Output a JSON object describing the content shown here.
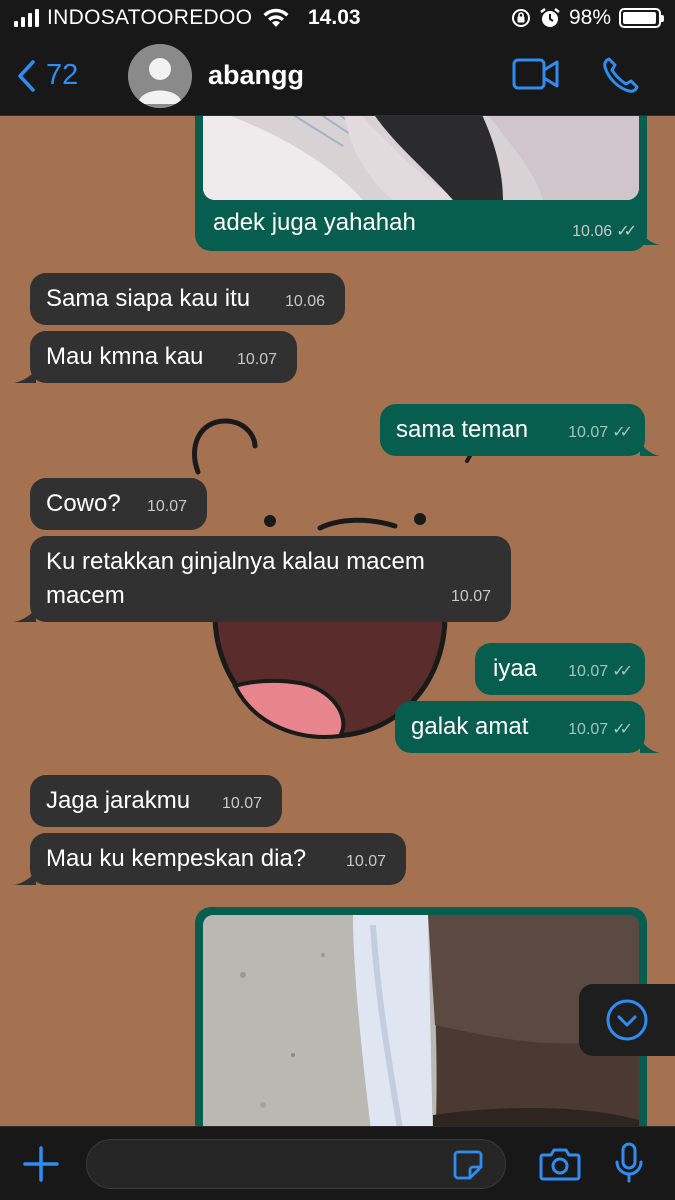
{
  "status_bar": {
    "carrier": "INDOSATOOREDOO",
    "time": "14.03",
    "battery": "98%",
    "battery_level": 0.98
  },
  "header": {
    "back_count": "72",
    "contact_name": "abangg"
  },
  "messages": [
    {
      "id": "m1",
      "dir": "out",
      "text": "adek juga yahahah",
      "time": "10.06",
      "has_media": true
    },
    {
      "id": "m2",
      "dir": "in",
      "text": "Sama siapa kau itu",
      "time": "10.06"
    },
    {
      "id": "m3",
      "dir": "in",
      "text": "Mau kmna kau",
      "time": "10.07"
    },
    {
      "id": "m4",
      "dir": "out",
      "text": "sama teman",
      "time": "10.07"
    },
    {
      "id": "m5",
      "dir": "in",
      "text": "Cowo?",
      "time": "10.07"
    },
    {
      "id": "m6",
      "dir": "in",
      "text": "Ku retakkan ginjalnya kalau macem macem",
      "time": "10.07"
    },
    {
      "id": "m7",
      "dir": "out",
      "text": "iyaa",
      "time": "10.07"
    },
    {
      "id": "m8",
      "dir": "out",
      "text": "galak amat",
      "time": "10.07"
    },
    {
      "id": "m9",
      "dir": "in",
      "text": "Jaga jarakmu",
      "time": "10.07"
    },
    {
      "id": "m10",
      "dir": "in",
      "text": "Mau ku kempeskan dia?",
      "time": "10.07"
    },
    {
      "id": "m11",
      "dir": "out",
      "text": "",
      "time": "",
      "has_media": true
    }
  ],
  "composer": {
    "placeholder": ""
  },
  "colors": {
    "wallpaper": "#a47250",
    "incoming": "#313131",
    "outgoing": "#075e4e",
    "accent": "#2f8df2",
    "bar": "#181818"
  },
  "icons": {
    "back": "chevron-left-icon",
    "video": "video-call-icon",
    "phone": "phone-call-icon",
    "scroll": "scroll-down-icon",
    "plus": "plus-icon",
    "sticker": "sticker-icon",
    "camera": "camera-icon",
    "mic": "microphone-icon"
  }
}
